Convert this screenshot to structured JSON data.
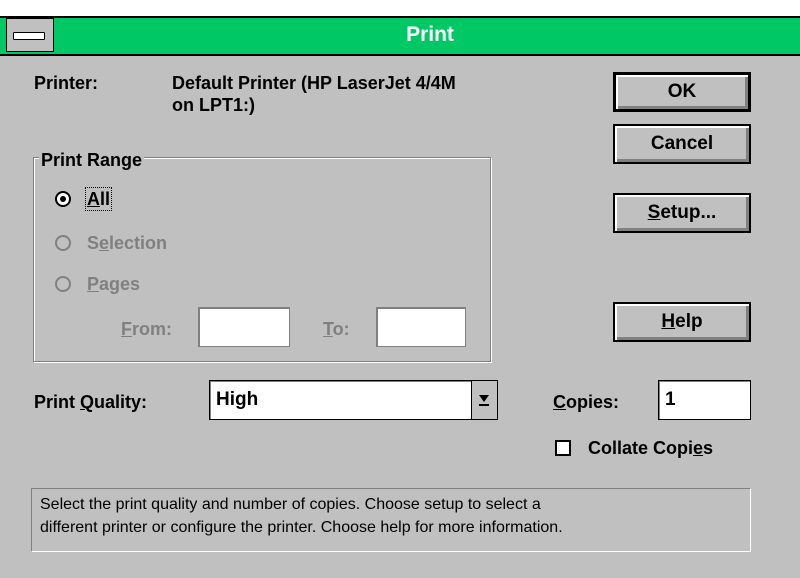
{
  "window": {
    "title": "Print"
  },
  "printer": {
    "label": "Printer:",
    "value_line1": "Default Printer (HP LaserJet 4/4M",
    "value_line2": "on LPT1:)"
  },
  "buttons": {
    "ok": "OK",
    "cancel": "Cancel",
    "setup_prefix": "S",
    "setup_rest": "etup...",
    "help_prefix": "H",
    "help_rest": "elp"
  },
  "print_range": {
    "title": "Print Range",
    "options": [
      {
        "label_prefix": "A",
        "label_rest": "ll",
        "selected": true,
        "enabled": true
      },
      {
        "label_prefix": "S",
        "label_mid": "e",
        "label_rest": "lection",
        "selected": false,
        "enabled": false
      },
      {
        "label_prefix": "P",
        "label_rest": "ages",
        "selected": false,
        "enabled": false
      }
    ],
    "from_prefix": "F",
    "from_rest": "rom:",
    "to_prefix": "T",
    "to_rest": "o:",
    "from_value": "",
    "to_value": ""
  },
  "print_quality": {
    "label_prefix": "Print ",
    "label_accel": "Q",
    "label_rest": "uality:",
    "value": "High"
  },
  "copies": {
    "label_accel": "C",
    "label_rest": "opies:",
    "value": "1"
  },
  "collate": {
    "label_prefix": "Collate Copi",
    "label_accel": "e",
    "label_rest": "s",
    "checked": false
  },
  "status_text": {
    "line1": "Select the print quality and number of copies.  Choose setup to select a",
    "line2": "different printer or configure the printer.  Choose help for more information."
  },
  "colors": {
    "title_bar": "#00c864",
    "face": "#c0c0c0",
    "disabled_text": "#808080"
  }
}
